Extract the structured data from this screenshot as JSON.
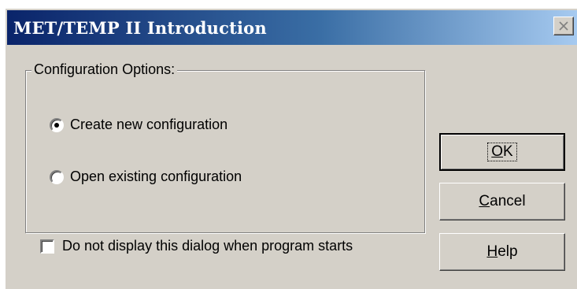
{
  "window": {
    "title": "MET/TEMP II Introduction",
    "close_icon": "close-icon"
  },
  "config_group": {
    "label": "Configuration Options:",
    "options": [
      {
        "label": "Create new configuration",
        "selected": true
      },
      {
        "label": "Open existing configuration",
        "selected": false
      }
    ]
  },
  "startup_checkbox": {
    "label": "Do not display this dialog when program starts",
    "checked": false
  },
  "buttons": {
    "ok": {
      "mnemonic": "O",
      "rest": "K"
    },
    "cancel": {
      "mnemonic": "C",
      "rest": "ancel"
    },
    "help": {
      "mnemonic": "H",
      "rest": "elp"
    }
  },
  "colors": {
    "face": "#d4d0c8",
    "title_start": "#0a246a",
    "title_end": "#a6caf0"
  }
}
